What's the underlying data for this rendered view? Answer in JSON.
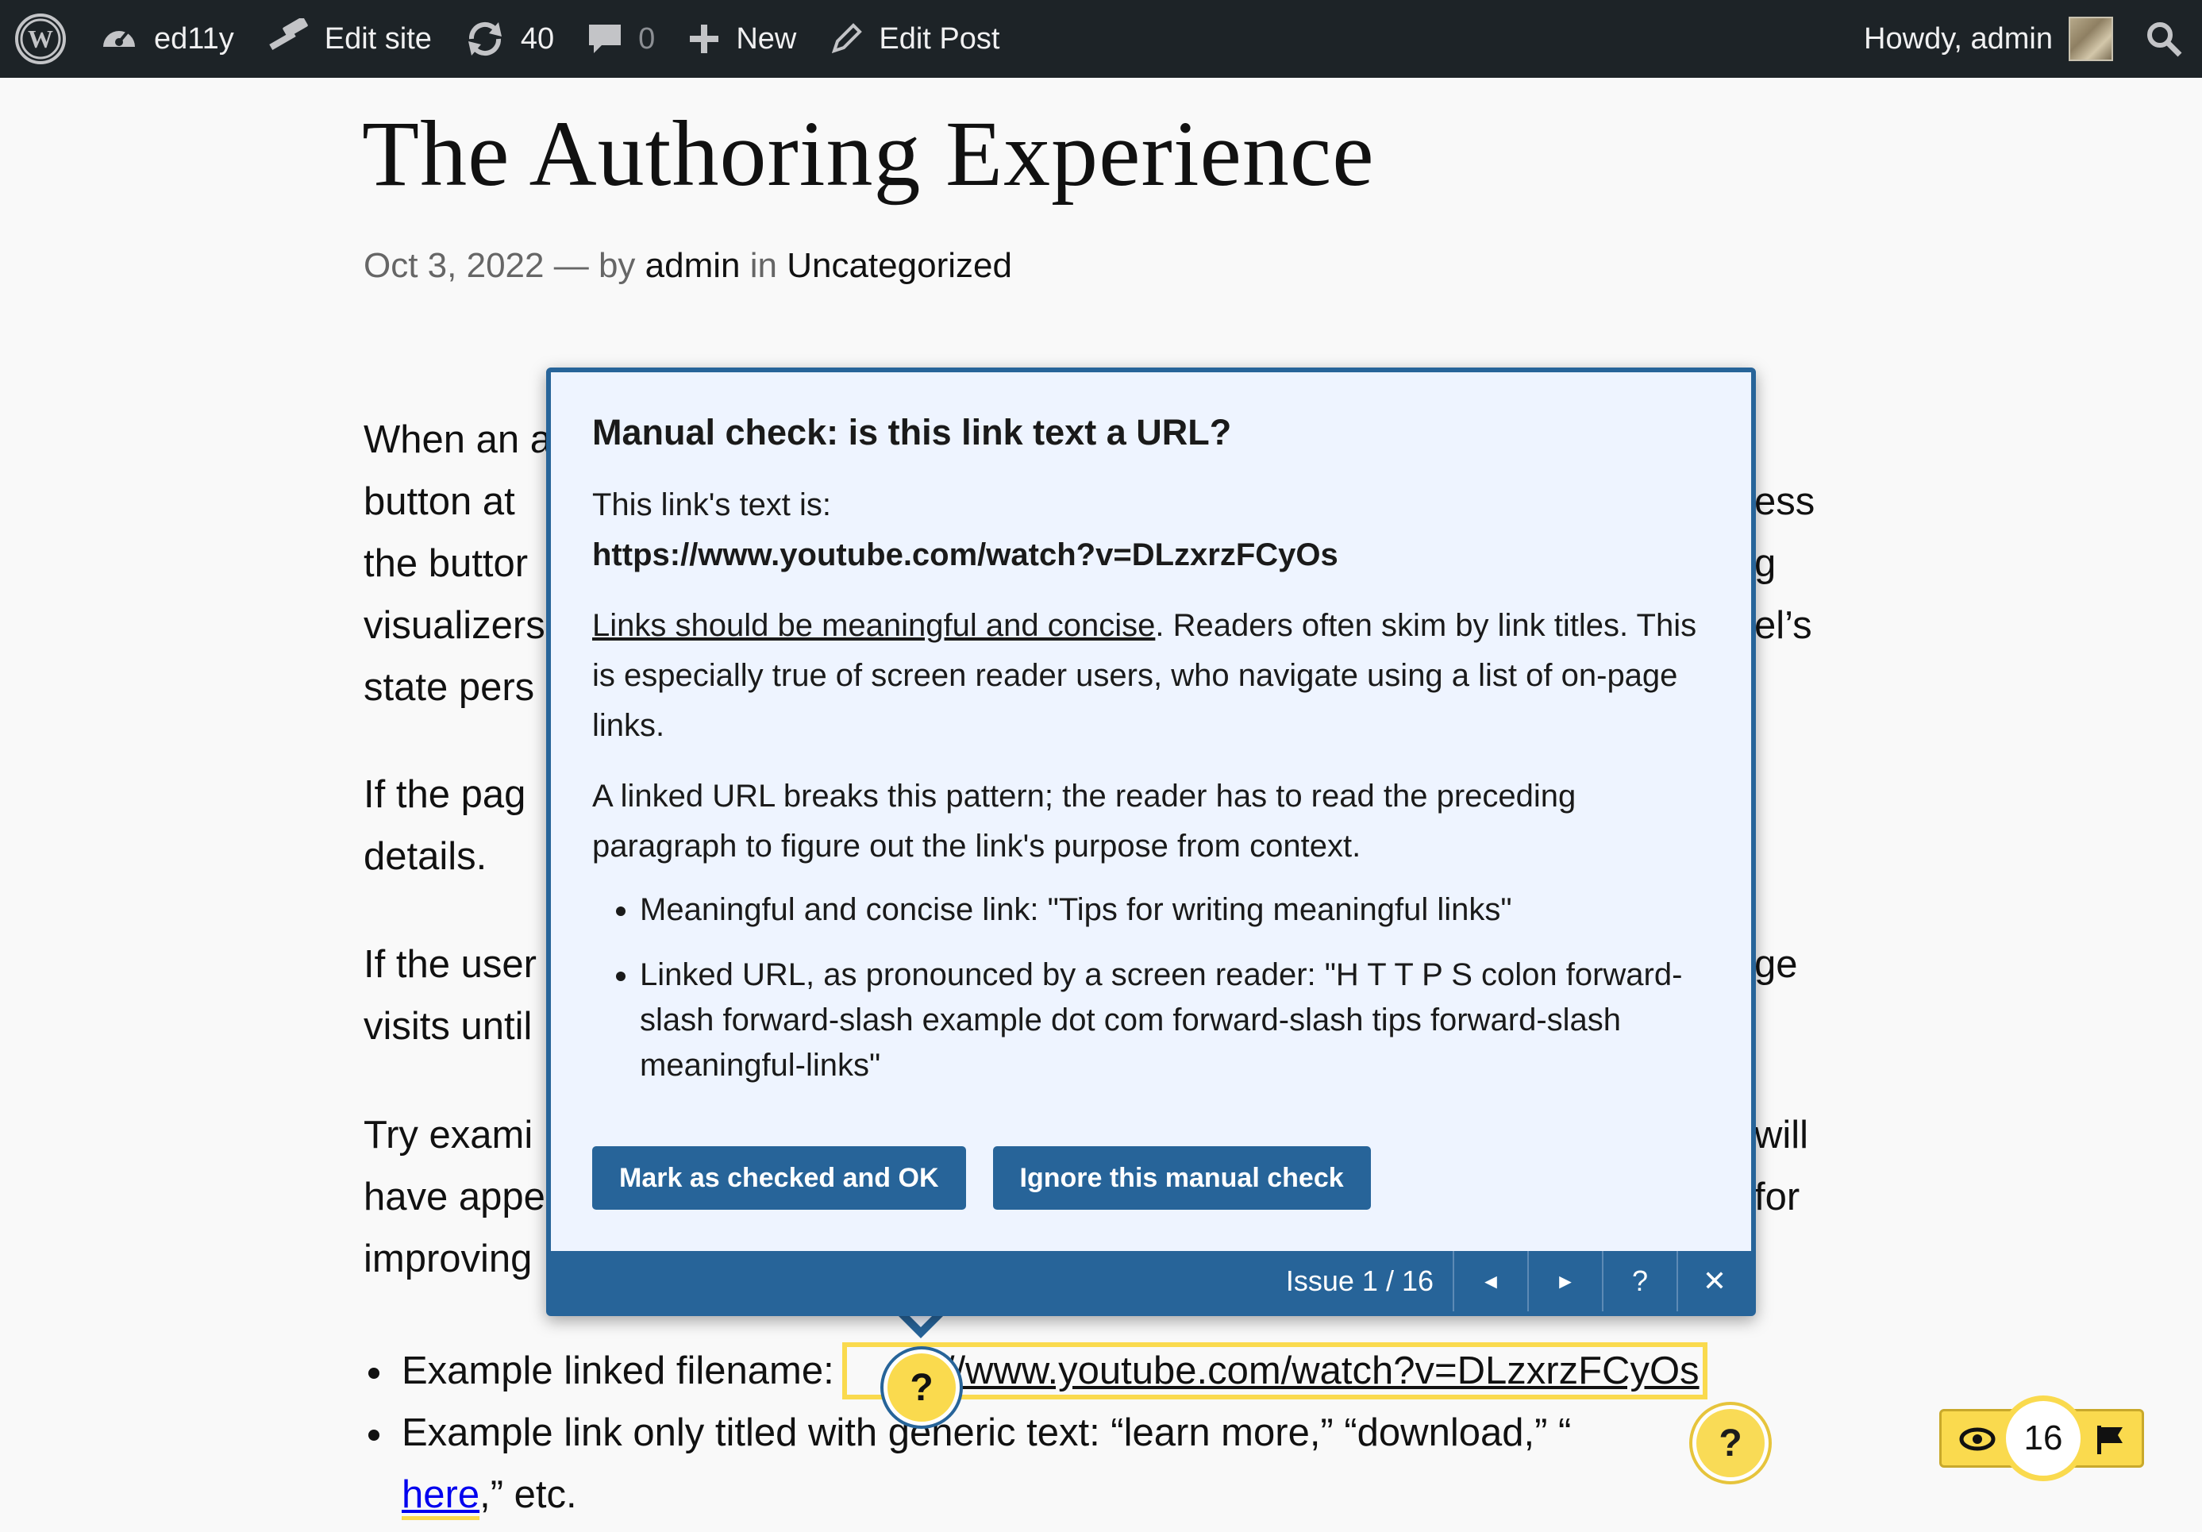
{
  "adminbar": {
    "site_name": "ed11y",
    "edit_site": "Edit site",
    "updates_count": "40",
    "comments_count": "0",
    "new_label": "New",
    "edit_post": "Edit Post",
    "howdy": "Howdy, admin"
  },
  "post": {
    "title": "The Authoring Experience",
    "date": "Oct 3, 2022",
    "by_sep": "— by",
    "author": "admin",
    "in_word": "in",
    "category": "Uncategorized"
  },
  "paragraphs": {
    "p1_left": [
      "When an a",
      "button at",
      "the buttor",
      "visualizers",
      "state pers"
    ],
    "p1_right": [
      "ess",
      "g",
      "el’s"
    ],
    "p2_left": [
      "If the pag",
      "details."
    ],
    "p3_left": [
      "If the user",
      "visits until"
    ],
    "p3_right": [
      "ge"
    ],
    "p4_left": [
      "Try exami",
      "have appe",
      "improving"
    ],
    "p4_right": [
      "will",
      "for"
    ]
  },
  "bullets": {
    "b1_label": "Example linked filename:",
    "b1_link": "https://www.youtube.com/watch?v=DLzxrzFCyOs",
    "b1_link_visible": "s://www.youtube.com/watch?v=DLzxrzFCyOs",
    "b2_label": "Example link only titled with generic text: “learn more,” “download,” “",
    "b2_here": "here",
    "b2_tail": ",” etc."
  },
  "tooltip": {
    "heading": "Manual check: is this link text a URL?",
    "intro": "This link's text is:",
    "url": "https://www.youtube.com/watch?v=DLzxrzFCyOs",
    "guide_link": "Links should be meaningful and concise",
    "para1_rest": ". Readers often skim by link titles. This is especially true of screen reader users, who navigate using a list of on-page links.",
    "para2": "A linked URL breaks this pattern; the reader has to read the preceding paragraph to figure out the link's purpose from context.",
    "list": [
      "Meaningful and concise link: \"Tips for writing meaningful links\"",
      "Linked URL, as pronounced by a screen reader: \"H T T P S colon forward-slash forward-slash example dot com forward-slash tips forward-slash meaningful-links\""
    ],
    "btn_mark_ok": "Mark as checked and OK",
    "btn_ignore": "Ignore this manual check",
    "issue_label": "Issue 1 / 16",
    "prev": "◄",
    "next": "►",
    "help": "?",
    "close": "✕"
  },
  "markers": {
    "active": "?",
    "second": "?"
  },
  "ed11y_panel": {
    "count": "16"
  },
  "colors": {
    "adminbar_bg": "#1d2327",
    "accent_blue": "#276499",
    "marker_yellow": "#fada4e",
    "tip_bg": "#eef4ff"
  }
}
